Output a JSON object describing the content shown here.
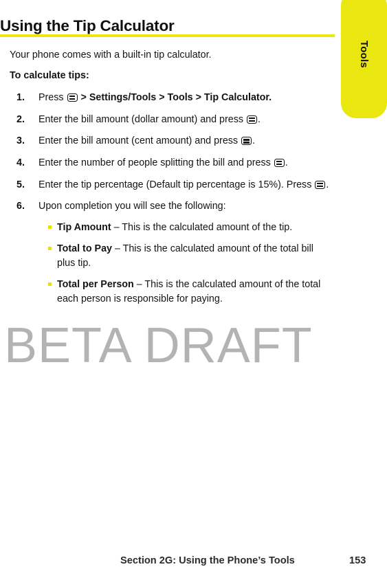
{
  "page": {
    "title": "Using the Tip Calculator",
    "rule_color": "#e9e70f"
  },
  "side_tab": {
    "label": "Tools",
    "color": "#e9e70f"
  },
  "body": {
    "intro": "Your phone comes with a built-in tip calculator.",
    "lead_in": "To calculate tips:"
  },
  "steps": [
    {
      "number": "1.",
      "prefix": "Press ",
      "icon": "menu-ok-key-icon",
      "chevron": " > ",
      "bold_path": "Settings/Tools > Tools > Tip Calculator.",
      "suffix": ""
    },
    {
      "number": "2.",
      "prefix": "Enter the bill amount (dollar amount) and press ",
      "icon": "menu-ok-key-icon",
      "suffix": "."
    },
    {
      "number": "3.",
      "prefix": "Enter the bill amount (cent amount) and press ",
      "icon": "menu-ok-key-icon",
      "suffix": "."
    },
    {
      "number": "4.",
      "prefix": "Enter the number of people splitting the bill and press ",
      "icon": "menu-ok-key-icon",
      "suffix": "."
    },
    {
      "number": "5.",
      "prefix": "Enter the tip percentage (Default tip percentage is 15%). Press ",
      "icon": "menu-ok-key-icon",
      "suffix": "."
    },
    {
      "number": "6.",
      "prefix": "Upon completion you will see the following:",
      "icon": null,
      "suffix": ""
    }
  ],
  "sub_items": [
    {
      "term": "Tip Amount",
      "description": " – This is the calculated amount of the tip."
    },
    {
      "term": "Total to Pay",
      "description": " – This is the calculated amount of the total bill plus tip."
    },
    {
      "term": "Total per Person",
      "description": " – This is the calculated amount of the total each person is responsible for paying."
    }
  ],
  "watermark": {
    "text": "BETA DRAFT"
  },
  "footer": {
    "section": "Section 2G: Using the Phone’s Tools",
    "page_number": "153"
  }
}
